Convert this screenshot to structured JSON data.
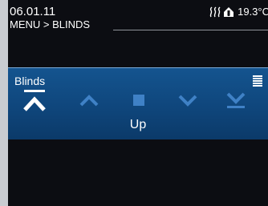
{
  "header": {
    "date": "06.01.11",
    "breadcrumb": "MENU > BLINDS",
    "temperature": "19.3°C"
  },
  "panel": {
    "title": "Blinds",
    "action_label": "Up",
    "selected_action": "top",
    "actions": [
      {
        "name": "top"
      },
      {
        "name": "up"
      },
      {
        "name": "stop"
      },
      {
        "name": "down"
      },
      {
        "name": "bottom"
      }
    ]
  },
  "colors": {
    "panel": "#0f467c",
    "panel_border": "#7aa9d6",
    "active": "#ffffff",
    "inactive": "#3f81c6",
    "background": "#0c0d12"
  }
}
